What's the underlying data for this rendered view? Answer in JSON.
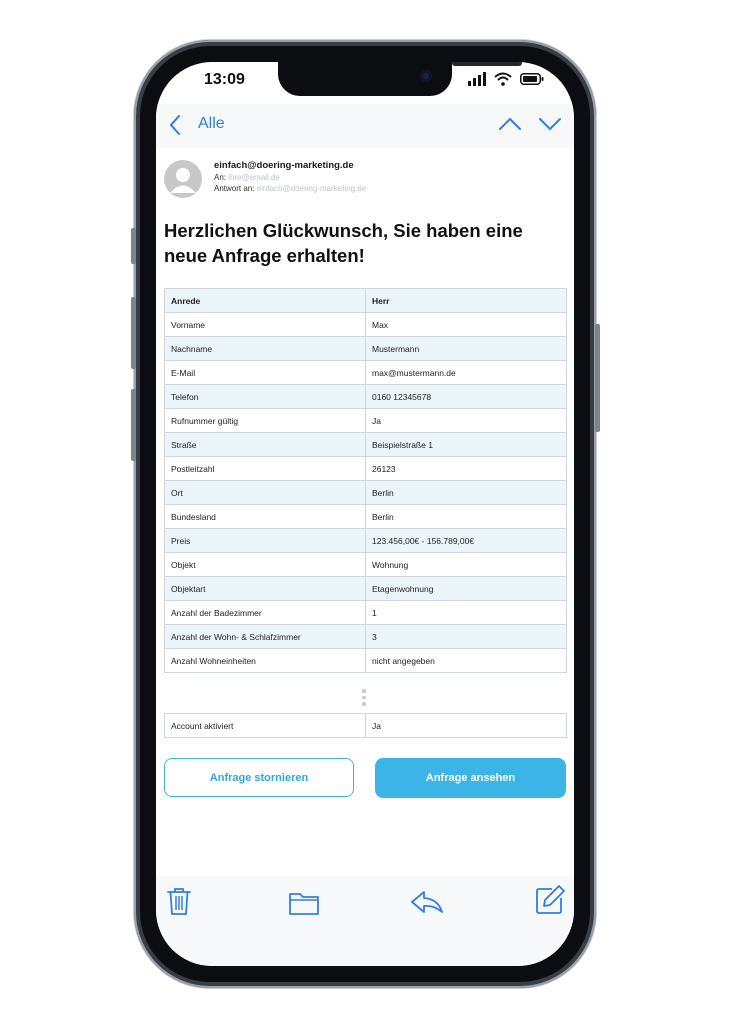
{
  "status": {
    "time": "13:09"
  },
  "nav": {
    "back_label": "Alle"
  },
  "email": {
    "sender": "einfach@doering-marketing.de",
    "to_label": "An:",
    "to_value": "ihre@email.de",
    "reply_label": "Antwort an:",
    "reply_value": "einfach@doering-marketing.de",
    "title": "Herzlichen Glückwunsch, Sie haben eine neue Anfrage erhalten!"
  },
  "table": {
    "header": [
      "Anrede",
      "Herr"
    ],
    "rows": [
      [
        "Vorname",
        "Max"
      ],
      [
        "Nachname",
        "Mustermann"
      ],
      [
        "E-Mail",
        "max@mustermann.de"
      ],
      [
        "Telefon",
        "0160 12345678"
      ],
      [
        "Rufnummer gültig",
        "Ja"
      ],
      [
        "Straße",
        "Beispielstraße 1"
      ],
      [
        "Postleitzahl",
        "26123"
      ],
      [
        "Ort",
        "Berlin"
      ],
      [
        "Bundesland",
        "Berlin"
      ],
      [
        "Preis",
        "123.456,00€ - 156.789,00€"
      ],
      [
        "Objekt",
        "Wohnung"
      ],
      [
        "Objektart",
        "Etagenwohnung"
      ],
      [
        "Anzahl der Badezimmer",
        "1"
      ],
      [
        "Anzahl der Wohn- & Schlafzimmer",
        "3"
      ],
      [
        "Anzahl Wohneinheiten",
        "nicht angegeben"
      ]
    ],
    "footer_rows": [
      [
        "Account aktiviert",
        "Ja"
      ]
    ]
  },
  "buttons": {
    "cancel": "Anfrage stornieren",
    "view": "Anfrage ansehen"
  },
  "colors": {
    "accent_blue": "#2f7ee6",
    "button_blue": "#3bb4e8",
    "row_highlight": "#eaf6fa"
  },
  "icons": {
    "toolbar": [
      "trash-icon",
      "folder-icon",
      "reply-icon",
      "compose-icon"
    ]
  }
}
